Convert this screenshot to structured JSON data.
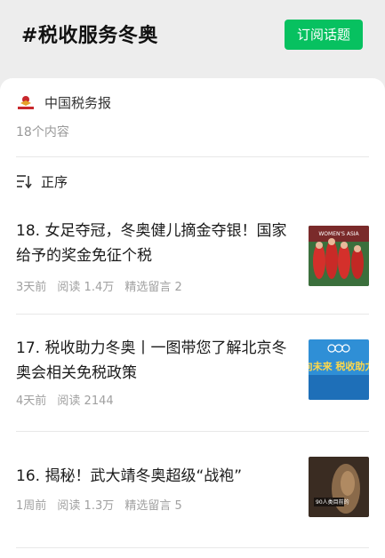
{
  "topic": {
    "title": "#税收服务冬奥",
    "subscribe_label": "订阅话题"
  },
  "account": {
    "name": "中国税务报",
    "content_count": "18个内容"
  },
  "sort": {
    "label": "正序"
  },
  "articles": [
    {
      "title": "18. 女足夺冠，冬奥健儿摘金夺银！国家给予的奖金免征个税",
      "time": "3天前",
      "reads": "阅读 1.4万",
      "comments": "精选留言 2",
      "thumb_text": "WOMEN'S ASIA"
    },
    {
      "title": "17. 税收助力冬奥丨一图带您了解北京冬奥会相关免税政策",
      "time": "4天前",
      "reads": "阅读 2144",
      "comments": "",
      "thumb_text": "起向未来 税收助力冬"
    },
    {
      "title": "16. 揭秘！武大靖冬奥超级“战袍”",
      "time": "1周前",
      "reads": "阅读 1.3万",
      "comments": "精选留言 5",
      "thumb_text": "90人类目前的"
    }
  ],
  "colors": {
    "accent": "#07c160",
    "page_bg": "#ededed",
    "meta_text": "#a0a0a0"
  }
}
